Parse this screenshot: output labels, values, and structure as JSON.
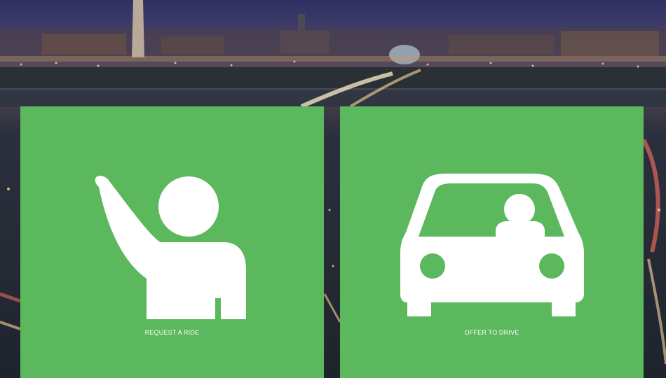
{
  "tiles": {
    "request": {
      "label": "REQUEST A RIDE",
      "icon": "hand-raise-person-icon"
    },
    "offer": {
      "label": "OFFER TO DRIVE",
      "icon": "car-driver-icon"
    }
  },
  "colors": {
    "tile_green": "#5cb85c",
    "icon_white": "#ffffff",
    "background_night": "#2a2f3c"
  }
}
